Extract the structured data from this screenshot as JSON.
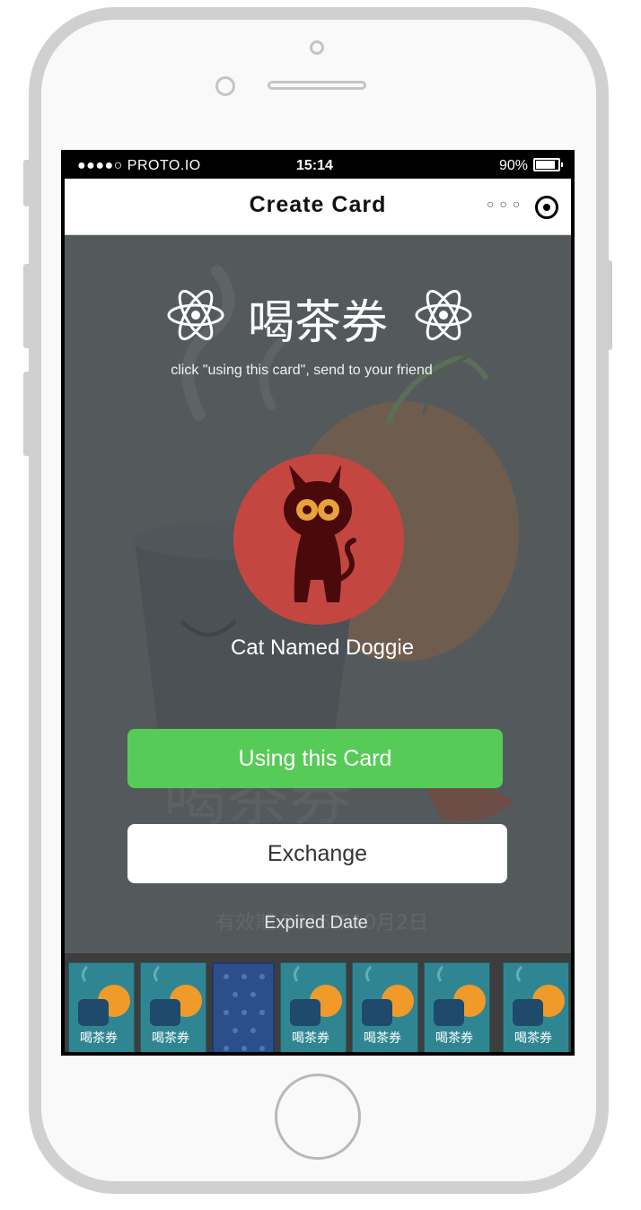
{
  "status_bar": {
    "carrier": "●●●●○ PROTO.IO",
    "time": "15:14",
    "battery": "90%"
  },
  "navbar": {
    "title": "Create Card",
    "more_icon": "more-dots-icon",
    "target_icon": "target-icon"
  },
  "card": {
    "heading": "喝茶券",
    "subtitle": "click \"using this card\", send to your friend",
    "cat_name": "Cat Named Doggie",
    "use_button": "Using this Card",
    "exchange_button": "Exchange",
    "expired_label": "Expired Date",
    "background_text": "有效期 2016年10月2日"
  },
  "colors": {
    "overlay": "#545a5c",
    "use_button": "#57cb58",
    "avatar": "#c44640",
    "thumb": "#2f8692",
    "thumb_selected": "#2c4f8c"
  },
  "thumbnails": [
    {
      "style": "tea",
      "label": "喝茶券"
    },
    {
      "style": "tea",
      "label": "喝茶券"
    },
    {
      "style": "drops",
      "label": ""
    },
    {
      "style": "tea",
      "label": "喝茶券"
    },
    {
      "style": "tea",
      "label": "喝茶券"
    },
    {
      "style": "tea",
      "label": "喝茶券"
    },
    {
      "style": "tea",
      "label": "喝茶券"
    }
  ]
}
